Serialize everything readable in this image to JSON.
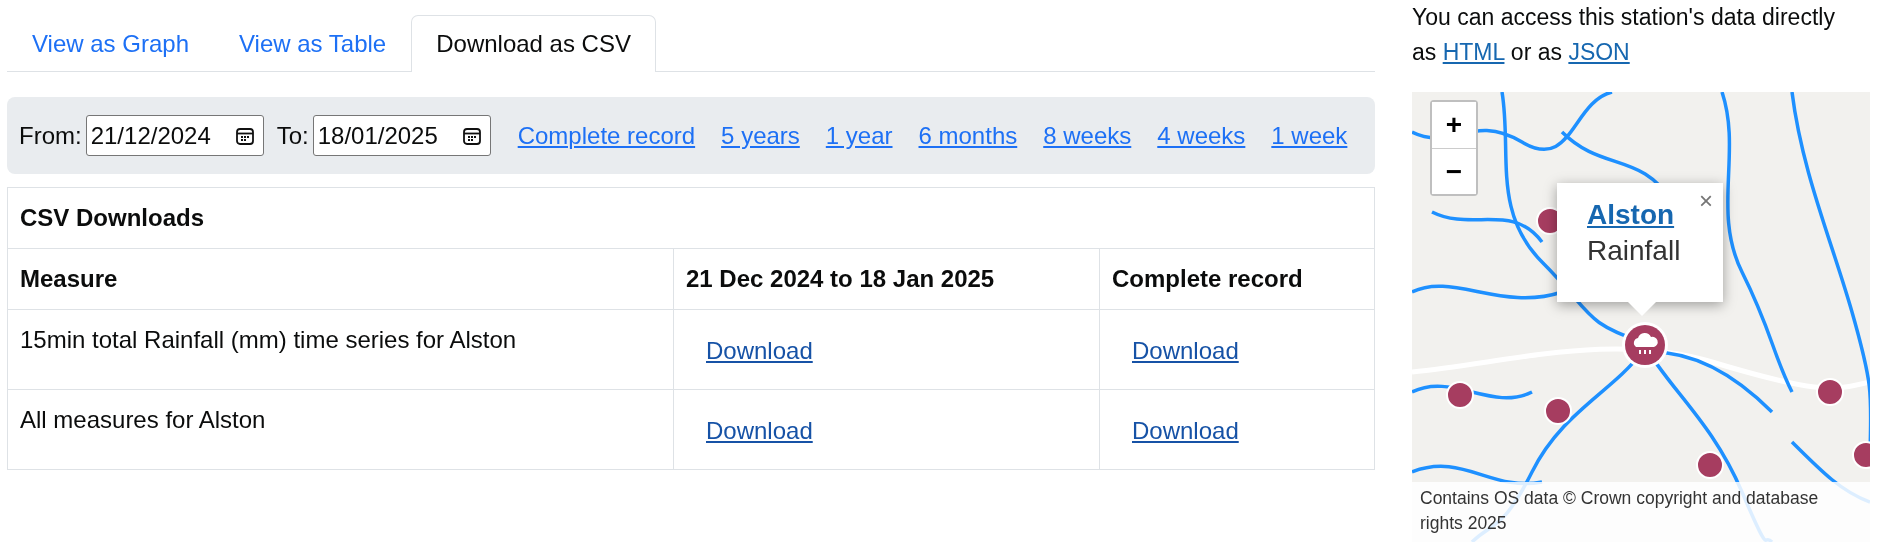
{
  "tabs": [
    {
      "label": "View as Graph",
      "selected": false
    },
    {
      "label": "View as Table",
      "selected": false
    },
    {
      "label": "Download as CSV",
      "selected": true
    }
  ],
  "filter": {
    "from_label": "From:",
    "from_value": "21/12/2024",
    "to_label": "To:",
    "to_value": "18/01/2025",
    "ranges": [
      "Complete record",
      "5 years",
      "1 year",
      "6 months",
      "8 weeks",
      "4 weeks",
      "1 week"
    ]
  },
  "table": {
    "title": "CSV Downloads",
    "columns": [
      "Measure",
      "21 Dec 2024 to 18 Jan 2025",
      "Complete record"
    ],
    "rows": [
      {
        "measure": "15min total Rainfall (mm) time series for Alston",
        "period_link": "Download",
        "record_link": "Download"
      },
      {
        "measure": "All measures for Alston",
        "period_link": "Download",
        "record_link": "Download"
      }
    ]
  },
  "sidebar": {
    "intro": {
      "text": "You can access this station's data directly as",
      "links": [
        "HTML",
        "JSON"
      ],
      "joiner": "or as"
    },
    "map": {
      "kind": "picture",
      "zoom_in": "+",
      "zoom_out": "−",
      "popup": {
        "title": "Alston",
        "subtitle": "Rainfall",
        "close": "×"
      },
      "attribution": "Contains OS data © Crown copyright and database rights 2025"
    }
  }
}
